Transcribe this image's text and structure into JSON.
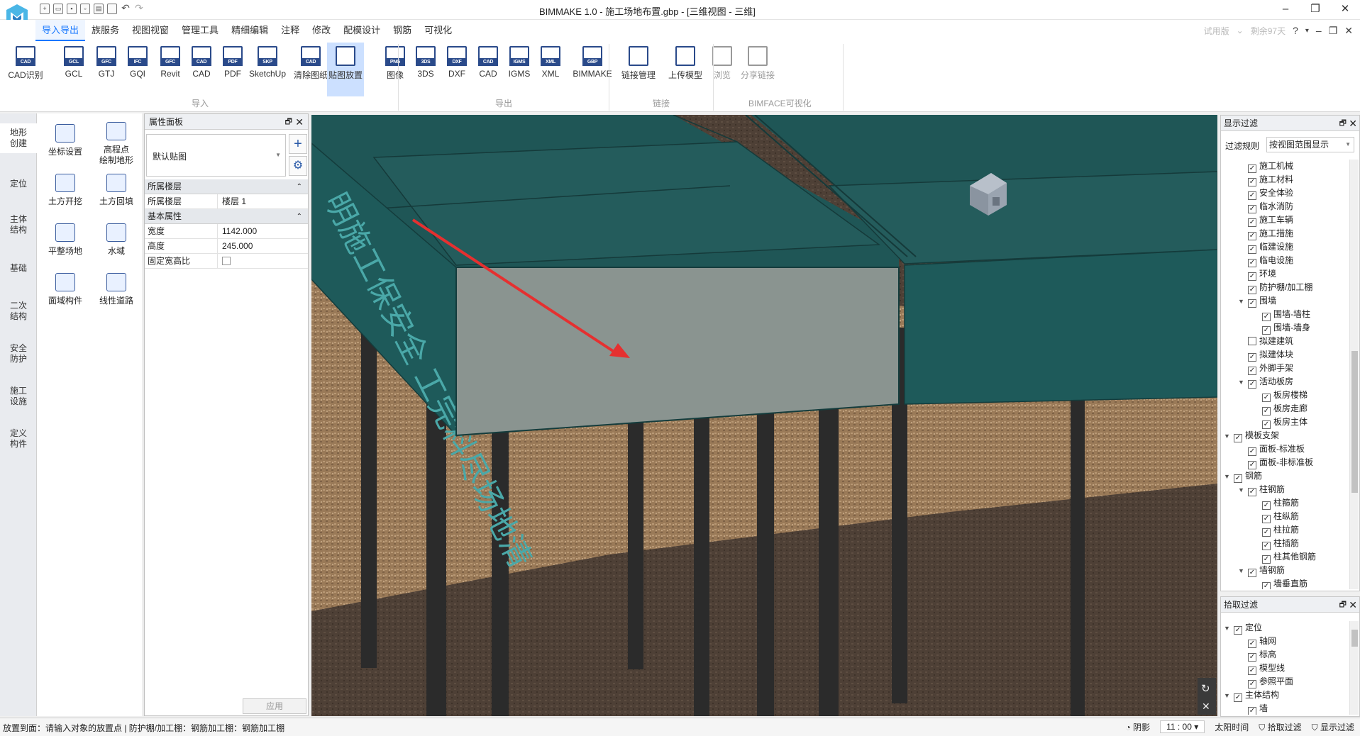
{
  "app": {
    "title": "BIMMAKE 1.0 - 施工场地布置.gbp - [三维视图 - 三维]",
    "trial": "试用版",
    "days_left": "剩余97天"
  },
  "menus": [
    "导入导出",
    "族服务",
    "视图视窗",
    "管理工具",
    "精细编辑",
    "注释",
    "修改",
    "配模设计",
    "钢筋",
    "可视化"
  ],
  "ribbon": {
    "import_label": "导入",
    "export_label": "导出",
    "link_label": "链接",
    "bimface_label": "BIMFACE可视化",
    "buttons": [
      {
        "label": "CAD识别",
        "badge": "CAD"
      },
      {
        "label": "GCL",
        "badge": "GCL"
      },
      {
        "label": "GTJ",
        "badge": "GFC"
      },
      {
        "label": "GQI",
        "badge": "IFC"
      },
      {
        "label": "Revit",
        "badge": "GFC"
      },
      {
        "label": "CAD",
        "badge": "CAD"
      },
      {
        "label": "PDF",
        "badge": "PDF"
      },
      {
        "label": "SketchUp",
        "badge": "SKP"
      },
      {
        "label": "清除图纸",
        "badge": "CAD"
      },
      {
        "label": "贴图放置",
        "badge": ""
      },
      {
        "label": "图像",
        "badge": "PNG"
      },
      {
        "label": "3DS",
        "badge": "3DS"
      },
      {
        "label": "DXF",
        "badge": "DXF"
      },
      {
        "label": "CAD",
        "badge": "CAD"
      },
      {
        "label": "IGMS",
        "badge": "IGMS"
      },
      {
        "label": "XML",
        "badge": "XML"
      },
      {
        "label": "BIMMAKE",
        "badge": "GBP"
      },
      {
        "label": "链接管理",
        "badge": ""
      },
      {
        "label": "上传模型",
        "badge": ""
      },
      {
        "label": "浏览",
        "badge": ""
      },
      {
        "label": "分享链接",
        "badge": ""
      }
    ]
  },
  "vtabs": [
    "地形\n创建",
    "定位",
    "主体\n结构",
    "基础",
    "二次\n结构",
    "安全\n防护",
    "施工\n设施",
    "定义\n构件"
  ],
  "tools": [
    "坐标设置",
    "高程点\n绘制地形",
    "土方开挖",
    "土方回填",
    "平整场地",
    "水域",
    "面域构件",
    "线性道路"
  ],
  "props": {
    "title": "属性面板",
    "type": "默认贴图",
    "sect_level": "所属楼层",
    "level_key": "所属楼层",
    "level_val": "楼层 1",
    "sect_basic": "基本属性",
    "width_key": "宽度",
    "width_val": "1142.000",
    "height_key": "高度",
    "height_val": "245.000",
    "ratio_key": "固定宽高比",
    "apply": "应用"
  },
  "viewport": {
    "banner_text": "明施工保安全 工完料尽场地清"
  },
  "display_filter": {
    "title": "显示过滤",
    "rule_label": "过滤规则",
    "rule_value": "按视图范围显示",
    "items": [
      {
        "label": "施工机械",
        "level": 2,
        "checked": true,
        "exp": ""
      },
      {
        "label": "施工材料",
        "level": 2,
        "checked": true,
        "exp": ""
      },
      {
        "label": "安全体验",
        "level": 2,
        "checked": true,
        "exp": ""
      },
      {
        "label": "临水消防",
        "level": 2,
        "checked": true,
        "exp": ""
      },
      {
        "label": "施工车辆",
        "level": 2,
        "checked": true,
        "exp": ""
      },
      {
        "label": "施工措施",
        "level": 2,
        "checked": true,
        "exp": ""
      },
      {
        "label": "临建设施",
        "level": 2,
        "checked": true,
        "exp": ""
      },
      {
        "label": "临电设施",
        "level": 2,
        "checked": true,
        "exp": ""
      },
      {
        "label": "环境",
        "level": 2,
        "checked": true,
        "exp": ""
      },
      {
        "label": "防护棚/加工棚",
        "level": 2,
        "checked": true,
        "exp": ""
      },
      {
        "label": "围墙",
        "level": 2,
        "checked": true,
        "exp": "▼"
      },
      {
        "label": "围墙-墙柱",
        "level": 3,
        "checked": true,
        "exp": ""
      },
      {
        "label": "围墙-墙身",
        "level": 3,
        "checked": true,
        "exp": ""
      },
      {
        "label": "拟建建筑",
        "level": 2,
        "checked": false,
        "exp": ""
      },
      {
        "label": "拟建体块",
        "level": 2,
        "checked": true,
        "exp": ""
      },
      {
        "label": "外脚手架",
        "level": 2,
        "checked": true,
        "exp": ""
      },
      {
        "label": "活动板房",
        "level": 2,
        "checked": true,
        "exp": "▼"
      },
      {
        "label": "板房楼梯",
        "level": 3,
        "checked": true,
        "exp": ""
      },
      {
        "label": "板房走廊",
        "level": 3,
        "checked": true,
        "exp": ""
      },
      {
        "label": "板房主体",
        "level": 3,
        "checked": true,
        "exp": ""
      },
      {
        "label": "模板支架",
        "level": 1,
        "checked": true,
        "exp": "▼"
      },
      {
        "label": "面板-标准板",
        "level": 2,
        "checked": true,
        "exp": ""
      },
      {
        "label": "面板-非标准板",
        "level": 2,
        "checked": true,
        "exp": ""
      },
      {
        "label": "钢筋",
        "level": 1,
        "checked": true,
        "exp": "▼"
      },
      {
        "label": "柱钢筋",
        "level": 2,
        "checked": true,
        "exp": "▼"
      },
      {
        "label": "柱箍筋",
        "level": 3,
        "checked": true,
        "exp": ""
      },
      {
        "label": "柱纵筋",
        "level": 3,
        "checked": true,
        "exp": ""
      },
      {
        "label": "柱拉筋",
        "level": 3,
        "checked": true,
        "exp": ""
      },
      {
        "label": "柱插筋",
        "level": 3,
        "checked": true,
        "exp": ""
      },
      {
        "label": "柱其他钢筋",
        "level": 3,
        "checked": true,
        "exp": ""
      },
      {
        "label": "墙钢筋",
        "level": 2,
        "checked": true,
        "exp": "▼"
      },
      {
        "label": "墙垂直筋",
        "level": 3,
        "checked": true,
        "exp": ""
      }
    ]
  },
  "pick_filter": {
    "title": "拾取过滤",
    "items": [
      {
        "label": "定位",
        "level": 1,
        "checked": true,
        "exp": "▼"
      },
      {
        "label": "轴网",
        "level": 2,
        "checked": true,
        "exp": ""
      },
      {
        "label": "标高",
        "level": 2,
        "checked": true,
        "exp": ""
      },
      {
        "label": "模型线",
        "level": 2,
        "checked": true,
        "exp": ""
      },
      {
        "label": "参照平面",
        "level": 2,
        "checked": true,
        "exp": ""
      },
      {
        "label": "主体结构",
        "level": 1,
        "checked": true,
        "exp": "▼"
      },
      {
        "label": "墙",
        "level": 2,
        "checked": true,
        "exp": ""
      }
    ]
  },
  "status": {
    "text": "放置到面：请输入对象的放置点 | 防护棚/加工棚：钢筋加工棚：钢筋加工棚",
    "shadow": "阴影",
    "time": "11 : 00",
    "sun": "太阳时间",
    "pick": "拾取过滤",
    "display": "显示过滤"
  }
}
